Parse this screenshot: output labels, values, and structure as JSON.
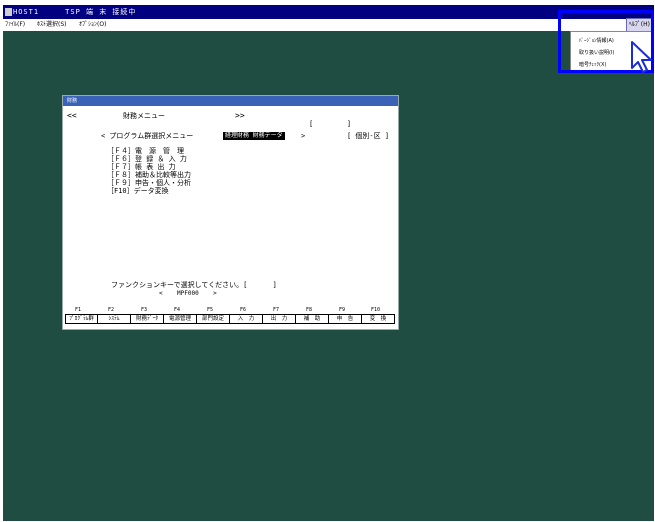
{
  "app": {
    "title": "HOST1     TSP 端 末 接続中",
    "menu": [
      {
        "label": "ﾌｧｲﾙ(F)"
      },
      {
        "label": "ﾎｽﾄ選択(S)"
      },
      {
        "label": "ｵﾌﾟｼｮﾝ(O)"
      }
    ],
    "help_menu_label": "ﾍﾙﾌﾟ(H)",
    "help_items": [
      "ﾊﾞｰｼﾞｮﾝ情報(A)",
      "取り扱い説明(I)",
      "暗号ﾁｪｯｸ(X)"
    ]
  },
  "dialog": {
    "title": "財務",
    "nav_prev": "<<",
    "header": "財務メニュー",
    "nav_next": ">>",
    "bracket_top": "[        ]",
    "program_menu_label": "< プログラム群選択メニュー",
    "selected_group": "経理財務 財務データ",
    "selected_suffix": ">",
    "mode": "[ 個別-区 ]",
    "menu_items": [
      "［Ｆ４］電　源　管　理",
      "［Ｆ６］登 録 ＆ 入 力",
      "［Ｆ７］帳 表 出 力",
      "［Ｆ８］補助＆比較等出力",
      "［Ｆ９］申告・個人・分析",
      "［F10］データ変換"
    ],
    "prompt": "ファンクションキーで選択してください。[      ]",
    "program_id": "<    MPF000    >",
    "fkey_numbers": [
      "F1",
      "F2",
      "F3",
      "F4",
      "F5",
      "F6",
      "F7",
      "F8",
      "F9",
      "F10"
    ],
    "fkey_labels": [
      "ﾌﾟﾛｸﾞﾗﾑ群",
      "ｼｽﾃﾑ",
      "財務ﾃﾞｰﾀ",
      "電源管理",
      "部門設定",
      "入　力",
      "出　力",
      "補　助",
      "申　告",
      "変　換"
    ]
  }
}
